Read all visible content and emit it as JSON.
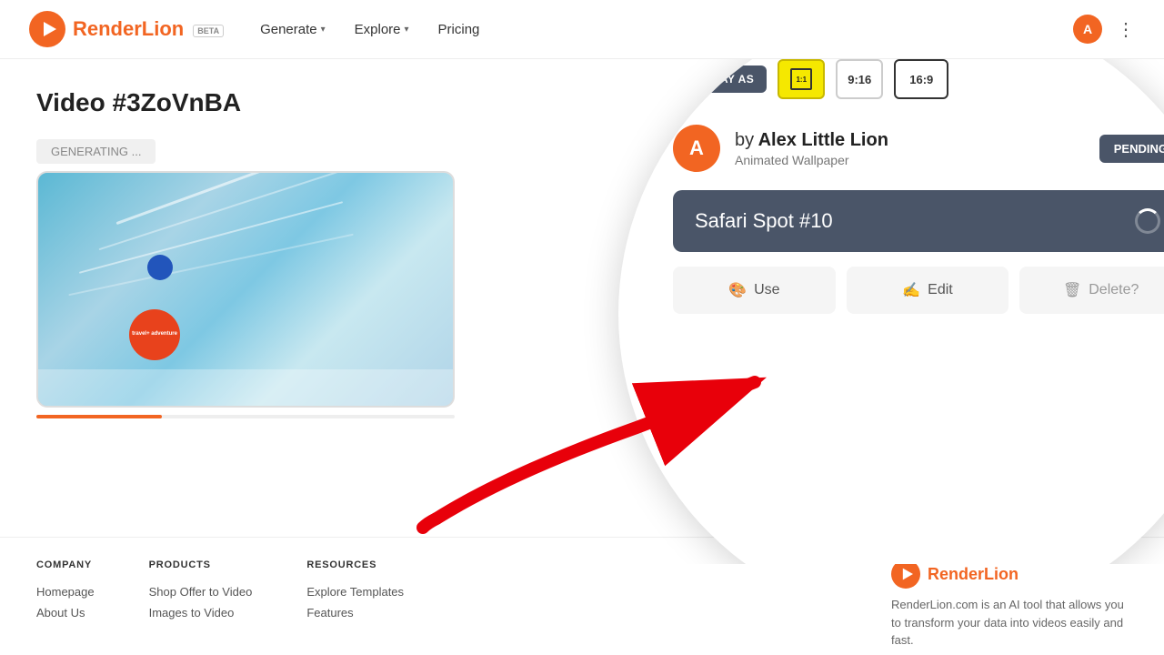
{
  "header": {
    "logo_text": "RenderLion",
    "beta": "BETA",
    "nav": [
      {
        "label": "Generate",
        "has_arrow": true
      },
      {
        "label": "Explore",
        "has_arrow": true
      },
      {
        "label": "Pricing",
        "has_arrow": false
      }
    ],
    "avatar_letter": "A",
    "dots": "⋮"
  },
  "main": {
    "video_title": "Video #3ZoVnBA",
    "generating_text": "GENERATING ...",
    "travel_badge": "travel+ adventure",
    "display_as": "DISPLAY AS",
    "ratios": [
      {
        "label": "1:1",
        "active": true
      },
      {
        "label": "9:16",
        "active": false
      },
      {
        "label": "16:9",
        "active": false
      }
    ],
    "user": {
      "by": "by",
      "name": "Alex Little Lion",
      "subtitle": "Animated Wallpaper",
      "avatar_letter": "A"
    },
    "pending_label": "PENDING",
    "safari_title": "Safari Spot #10",
    "actions": [
      {
        "label": "Use",
        "icon": "🎨"
      },
      {
        "label": "Edit ✍",
        "icon": ""
      },
      {
        "label": "Delete?",
        "icon": "🗑"
      }
    ]
  },
  "footer": {
    "columns": [
      {
        "heading": "COMPANY",
        "links": [
          "Homepage",
          "About Us"
        ]
      },
      {
        "heading": "PRODUCTS",
        "links": [
          "Shop Offer to Video",
          "Images to Video"
        ]
      },
      {
        "heading": "RESOURCES",
        "links": [
          "Explore Templates",
          "Features"
        ]
      }
    ],
    "brand": {
      "name": "RenderLion",
      "description": "RenderLion.com is an AI tool that allows you to transform your data into videos easily and fast."
    }
  }
}
